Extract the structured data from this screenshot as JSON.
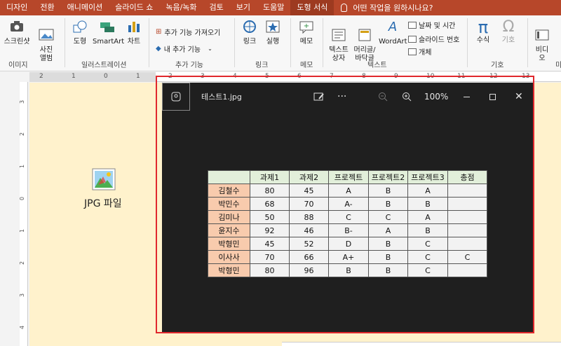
{
  "ribbon_tabs": [
    "디자인",
    "전환",
    "애니메이션",
    "슬라이드 쇼",
    "녹음/녹화",
    "검토",
    "보기",
    "도움말",
    "도형 서식"
  ],
  "active_tab": "도형 서식",
  "tell_me": "어떤 작업을 원하시나요?",
  "groups": {
    "image": {
      "label": "이미지",
      "screenshot": "스크린샷",
      "album": "사진\n앨범"
    },
    "illustrations": {
      "label": "일러스트레이션",
      "shapes": "도형",
      "smartart": "SmartArt",
      "chart": "차트"
    },
    "addins": {
      "label": "추가 기능",
      "get": "추가 기능 가져오기",
      "my": "내 추가 기능"
    },
    "link": {
      "label": "링크",
      "link": "링크",
      "action": "실행"
    },
    "comment": {
      "label": "메모",
      "comment": "메모"
    },
    "text": {
      "label": "텍스트",
      "textbox": "텍스트\n상자",
      "header": "머리글/\n바닥글",
      "wordart": "WordArt",
      "datetime": "날짜 및 시간",
      "slidenum": "슬라이드 번호",
      "object": "개체"
    },
    "symbols": {
      "label": "기호",
      "equation": "수식",
      "symbol": "기호"
    },
    "media": {
      "label": "미",
      "video": "비디\n오"
    }
  },
  "ruler_numbers": [
    "2",
    "1",
    "0",
    "1",
    "2",
    "3",
    "4",
    "5",
    "6",
    "7",
    "8",
    "9",
    "10",
    "11",
    "12",
    "13"
  ],
  "vruler_numbers": [
    "3",
    "2",
    "1",
    "0",
    "1",
    "2",
    "3",
    "4"
  ],
  "slide": {
    "icon_label": "JPG 파일"
  },
  "viewer": {
    "filename": "테스트1.jpg",
    "zoom": "100%",
    "more": "···"
  },
  "table": {
    "headers": [
      "",
      "과제1",
      "과제2",
      "프로젝트",
      "프로젝트2",
      "프로젝트3",
      "총점"
    ],
    "rows": [
      [
        "김철수",
        "80",
        "45",
        "A",
        "B",
        "A",
        ""
      ],
      [
        "박민수",
        "68",
        "70",
        "A-",
        "B",
        "B",
        ""
      ],
      [
        "김미나",
        "50",
        "88",
        "C",
        "C",
        "A",
        ""
      ],
      [
        "윤지수",
        "92",
        "46",
        "B-",
        "A",
        "B",
        ""
      ],
      [
        "박형민",
        "45",
        "52",
        "D",
        "B",
        "C",
        ""
      ],
      [
        "이사사",
        "70",
        "66",
        "A+",
        "B",
        "C",
        "C"
      ],
      [
        "박형민",
        "80",
        "96",
        "B",
        "B",
        "C",
        ""
      ]
    ]
  },
  "colors": {
    "ribbon": "#b7472a",
    "slide_bg": "#fff2cc",
    "viewer_bg": "#1f1f1f",
    "highlight": "#e0282d",
    "name_cell": "#f8cbad",
    "header_cell": "#e2efda"
  }
}
